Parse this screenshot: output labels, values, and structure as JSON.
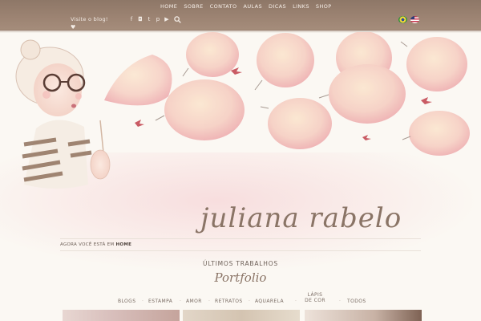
{
  "topbar": {
    "visit_label": "Visite o blog!",
    "nav": [
      "HOME",
      "SOBRE",
      "CONTATO",
      "AULAS",
      "DICAS",
      "LINKS",
      "SHOP"
    ],
    "social_icons": [
      "facebook-icon",
      "instagram-icon",
      "tumblr-icon",
      "pinterest-icon",
      "youtube-icon"
    ],
    "languages": [
      "Português (Brasil)",
      "English"
    ]
  },
  "header": {
    "logo_text": "juliana rabelo"
  },
  "breadcrumb": {
    "prefix": "AGORA VOCÊ ESTÁ EM",
    "current": "HOME"
  },
  "section": {
    "kicker": "ÚLTIMOS TRABALHOS",
    "title": "Portfolio"
  },
  "filters": [
    "BLOGS",
    "ESTAMPA",
    "AMOR",
    "RETRATOS",
    "AQUARELA",
    "LÁPIS DE COR",
    "TODOS"
  ],
  "colors": {
    "topbar": "#9d8473",
    "accent": "#8a7466",
    "balloon": "#f4c3c0",
    "balloon_light": "#f7dec9"
  }
}
